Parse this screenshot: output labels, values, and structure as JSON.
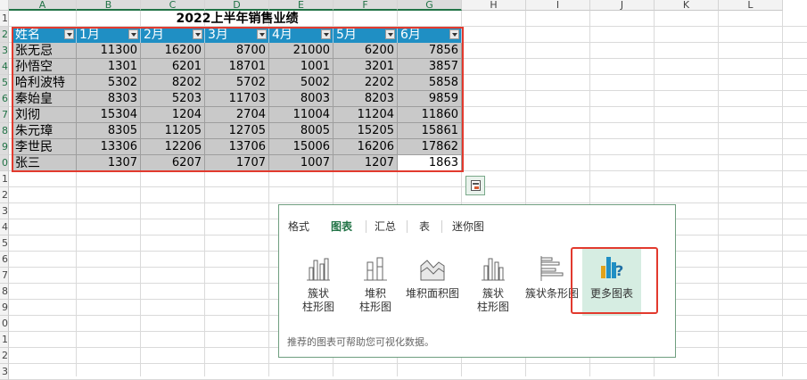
{
  "columns": [
    "A",
    "B",
    "C",
    "D",
    "E",
    "F",
    "G",
    "H",
    "I",
    "J",
    "K",
    "L"
  ],
  "rows": [
    "1",
    "2",
    "3",
    "4",
    "5",
    "6",
    "7",
    "8",
    "9",
    "0",
    "1",
    "2",
    "3",
    "4",
    "5",
    "6",
    "7",
    "8",
    "9",
    "0",
    "1",
    "2",
    "3"
  ],
  "title": "2022上半年销售业绩",
  "headers": [
    "姓名",
    "1月",
    "2月",
    "3月",
    "4月",
    "5月",
    "6月"
  ],
  "data": [
    [
      "张无忌",
      "11300",
      "16200",
      "8700",
      "21000",
      "6200",
      "7856"
    ],
    [
      "孙悟空",
      "1301",
      "6201",
      "18701",
      "1001",
      "3201",
      "3857"
    ],
    [
      "哈利波特",
      "5302",
      "8202",
      "5702",
      "5002",
      "2202",
      "5858"
    ],
    [
      "秦始皇",
      "8303",
      "5203",
      "11703",
      "8003",
      "8203",
      "9859"
    ],
    [
      "刘彻",
      "15304",
      "1204",
      "2704",
      "11004",
      "11204",
      "11860"
    ],
    [
      "朱元璋",
      "8305",
      "11205",
      "12705",
      "8005",
      "15205",
      "15861"
    ],
    [
      "李世民",
      "13306",
      "12206",
      "13706",
      "15006",
      "16206",
      "17862"
    ],
    [
      "张三",
      "1307",
      "6207",
      "1707",
      "1007",
      "1207",
      "1863"
    ]
  ],
  "quick_analysis": {
    "tabs": [
      "格式",
      "图表",
      "汇总",
      "表",
      "迷你图"
    ],
    "active_tab": "图表",
    "options": [
      {
        "label_line1": "簇状",
        "label_line2": "柱形图",
        "icon": "clustered-column-icon"
      },
      {
        "label_line1": "堆积",
        "label_line2": "柱形图",
        "icon": "stacked-column-icon"
      },
      {
        "label_line1": "堆积面积图",
        "label_line2": "",
        "icon": "stacked-area-icon"
      },
      {
        "label_line1": "簇状",
        "label_line2": "柱形图",
        "icon": "clustered-column-icon"
      },
      {
        "label_line1": "簇状条形图",
        "label_line2": "",
        "icon": "clustered-bar-icon"
      },
      {
        "label_line1": "更多图表",
        "label_line2": "",
        "icon": "more-charts-icon"
      }
    ],
    "hint": "推荐的图表可帮助您可视化数据。"
  },
  "colors": {
    "header_blue": "#1f8fc4",
    "data_gray": "#c9c9c9",
    "highlight_red": "#e23a2e",
    "excel_green": "#217346"
  }
}
